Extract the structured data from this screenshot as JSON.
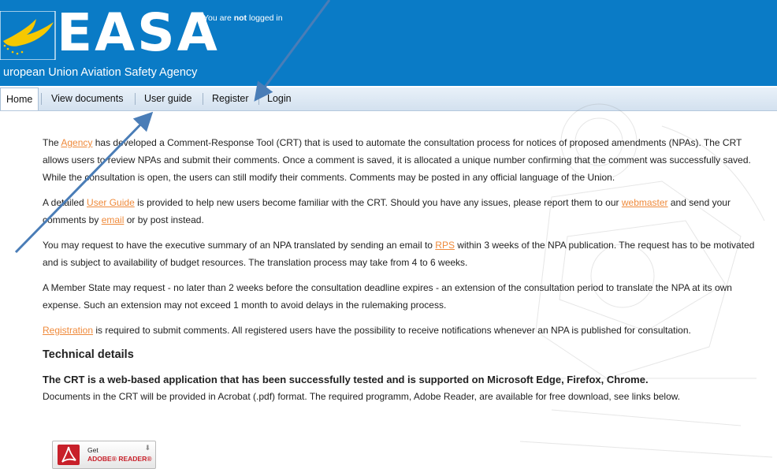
{
  "header": {
    "logo_letters": "EASA",
    "logo_subtitle": "uropean Union Aviation Safety Agency",
    "login_prefix": "You are ",
    "login_emph": "not",
    "login_suffix": " logged in",
    "background_color": "#0a7bc6"
  },
  "nav": {
    "items": [
      {
        "label": "Home"
      },
      {
        "label": "View documents"
      },
      {
        "label": "User guide"
      },
      {
        "label": "Register"
      },
      {
        "label": "Login"
      }
    ]
  },
  "content": {
    "p1": {
      "t1": "The ",
      "link1": "Agency",
      "t2": " has developed a Comment-Response Tool (CRT) that is used to automate the consultation process for notices of proposed amendments (NPAs). The CRT allows users to review NPAs and submit their comments. Once a comment is saved, it is allocated a unique number confirming that the comment was successfully saved. While the consultation is open, the users can still modify their comments. Comments may be posted in any official language of the Union."
    },
    "p2": {
      "t1": "A detailed ",
      "link1": "User Guide",
      "t2": " is provided to help new users become familiar with the CRT. Should you have any issues, please report them to our ",
      "link2": "webmaster",
      "t3": " and send your comments by ",
      "link3": "email",
      "t4": " or by post instead."
    },
    "p3": {
      "t1": "You may request to have the executive summary of an NPA translated by sending an email to ",
      "link1": "RPS",
      "t2": " within 3 weeks of the NPA publication. The request has to be motivated and is subject to availability of budget resources. The translation process may take from 4 to 6 weeks."
    },
    "p4": "A Member State may request - no later than 2 weeks before the consultation deadline expires - an extension of the consultation period to translate the NPA at its own expense. Such an extension may not exceed 1 month to avoid delays in the rulemaking process.",
    "p5": {
      "link1": "Registration",
      "t1": " is required to submit comments. All registered users have the possibility to receive notifications whenever an NPA is published for consultation."
    },
    "tech_title": "Technical details",
    "tech_bold": "The CRT is a web-based application that has been successfully tested and is supported on Microsoft Edge, Firefox, Chrome.",
    "tech_text": "Documents in the CRT will be provided in Acrobat (.pdf) format. The required programm, Adobe Reader, are available for free download, see links below.",
    "link_color": "#ef8a3b"
  },
  "adobe": {
    "get": "Get",
    "reader": "ADOBE® READER®"
  },
  "annotation_color": "#4a7db7"
}
